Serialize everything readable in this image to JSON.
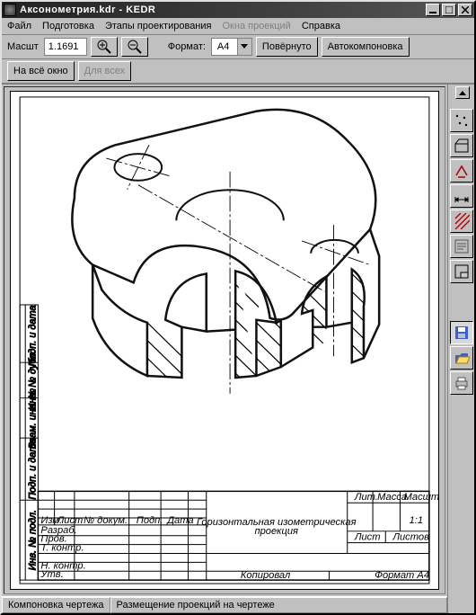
{
  "title": "Аксонометрия.kdr - KEDR",
  "menu": {
    "file": "Файл",
    "prep": "Подготовка",
    "stages": "Этапы проектирования",
    "proj": "Окна проекций",
    "help": "Справка"
  },
  "tb1": {
    "scale_lbl": "Масшт",
    "scale_val": "1.1691",
    "format_lbl": "Формат:",
    "format_val": "A4",
    "rotated": "Повёрнуто",
    "autolayout": "Автокомпоновка"
  },
  "tb2": {
    "fitwindow": "На всё окно",
    "forall": "Для всех"
  },
  "status": {
    "tab1": "Компоновка чертежа",
    "tab2": "Размещение проекций на чертеже"
  },
  "block": {
    "title1": "Горизонтальная изометрическая",
    "title2": "проекция",
    "scale": "1:1",
    "copies": "Копировал",
    "fmt": "Формат A4",
    "r0c0": "Изм.",
    "r0c1": "Лист",
    "r0c2": "№ докум.",
    "r0c3": "Подп.",
    "r0c4": "Дата",
    "r1c0": "Разраб.",
    "r2c0": "Пров.",
    "r3c0": "Т. контр.",
    "r4c0": "Н. контр.",
    "r5c0": "Утв.",
    "h_lit": "Лит.",
    "h_mass": "Масса",
    "h_scale": "Масштаб",
    "f_list": "Лист",
    "f_lists": "Листов",
    "side0": "Подп. и дата",
    "side1": "Инв. № дубл.",
    "side2": "Взам. инв. №",
    "side3": "Подп. и дата",
    "side4": "Инв. № подл."
  }
}
